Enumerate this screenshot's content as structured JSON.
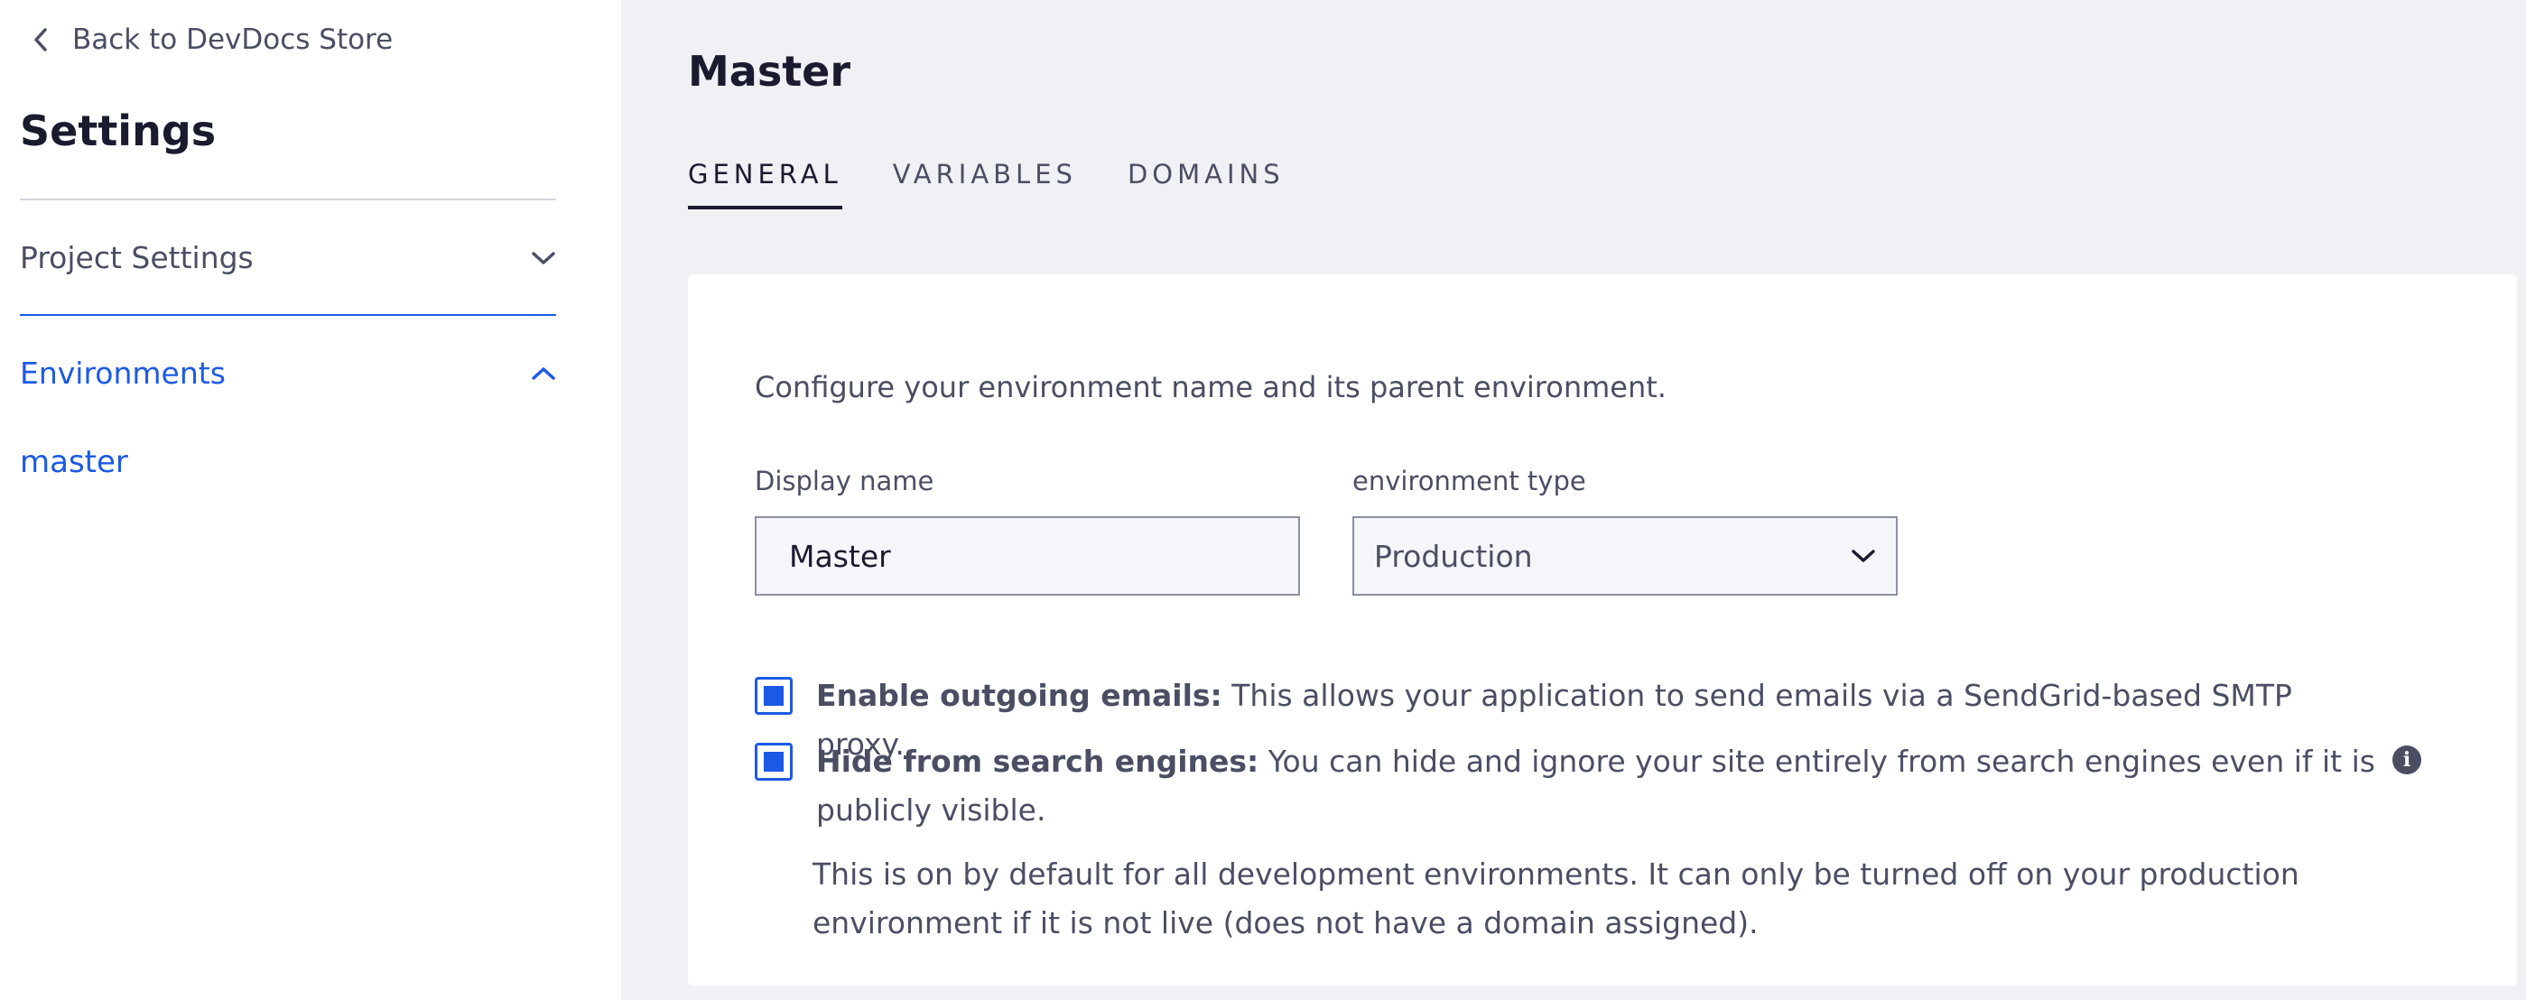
{
  "sidebar": {
    "back_label": "Back to DevDocs Store",
    "title": "Settings",
    "sections": [
      {
        "label": "Project Settings",
        "expanded": false
      },
      {
        "label": "Environments",
        "expanded": true
      }
    ],
    "environments": [
      "master"
    ]
  },
  "main": {
    "title": "Master",
    "tabs": [
      {
        "label": "GENERAL",
        "active": true
      },
      {
        "label": "VARIABLES",
        "active": false
      },
      {
        "label": "DOMAINS",
        "active": false
      }
    ],
    "description": "Configure your environment name and its parent environment.",
    "display_name": {
      "label": "Display name",
      "value": "Master"
    },
    "environment_type": {
      "label": "environment type",
      "value": "Production"
    },
    "options": [
      {
        "title": "Enable outgoing emails:",
        "text": " This allows your application to send emails via a SendGrid-based SMTP proxy.",
        "checked": true
      },
      {
        "title": "Hide from search engines:",
        "text": " You can hide and ignore your site entirely from search engines even if it is publicly visible.",
        "checked": true
      }
    ],
    "note": "This is on by default for all development environments. It can only be turned off on your production environment if it is not live (does not have a domain assigned).",
    "info_icon_glyph": "i"
  },
  "colors": {
    "accent": "#1c5ae6",
    "sidebar_bg": "#ffffff",
    "page_bg": "#f0f1f5",
    "text": "#4b4e63",
    "heading": "#1a1b2e"
  }
}
